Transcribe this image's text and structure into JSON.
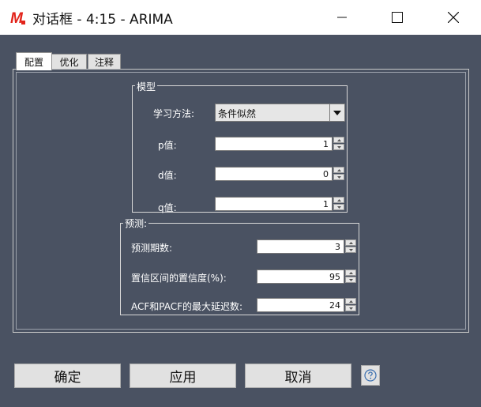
{
  "window": {
    "title": "对话框 - 4:15 - ARIMA",
    "logo_letter": "M",
    "logo_color": "#e2231a"
  },
  "tabs": [
    {
      "label": "配置",
      "active": true
    },
    {
      "label": "优化",
      "active": false
    },
    {
      "label": "注释",
      "active": false
    }
  ],
  "model": {
    "group_label": "模型",
    "method_label": "学习方法:",
    "method_value": "条件似然",
    "p_label": "p值:",
    "p_value": "1",
    "d_label": "d值:",
    "d_value": "0",
    "q_label": "q值:",
    "q_value": "1"
  },
  "forecast": {
    "group_label": "预测:",
    "periods_label": "预测期数:",
    "periods_value": "3",
    "confidence_label": "置信区间的置信度(%):",
    "confidence_value": "95",
    "maxlag_label": "ACF和PACF的最大延迟数:",
    "maxlag_value": "24"
  },
  "buttons": {
    "ok": "确定",
    "apply": "应用",
    "cancel": "取消"
  },
  "colors": {
    "background": "#4a5262",
    "titlebar": "#ffffff",
    "button_face": "#e1e1e1"
  }
}
